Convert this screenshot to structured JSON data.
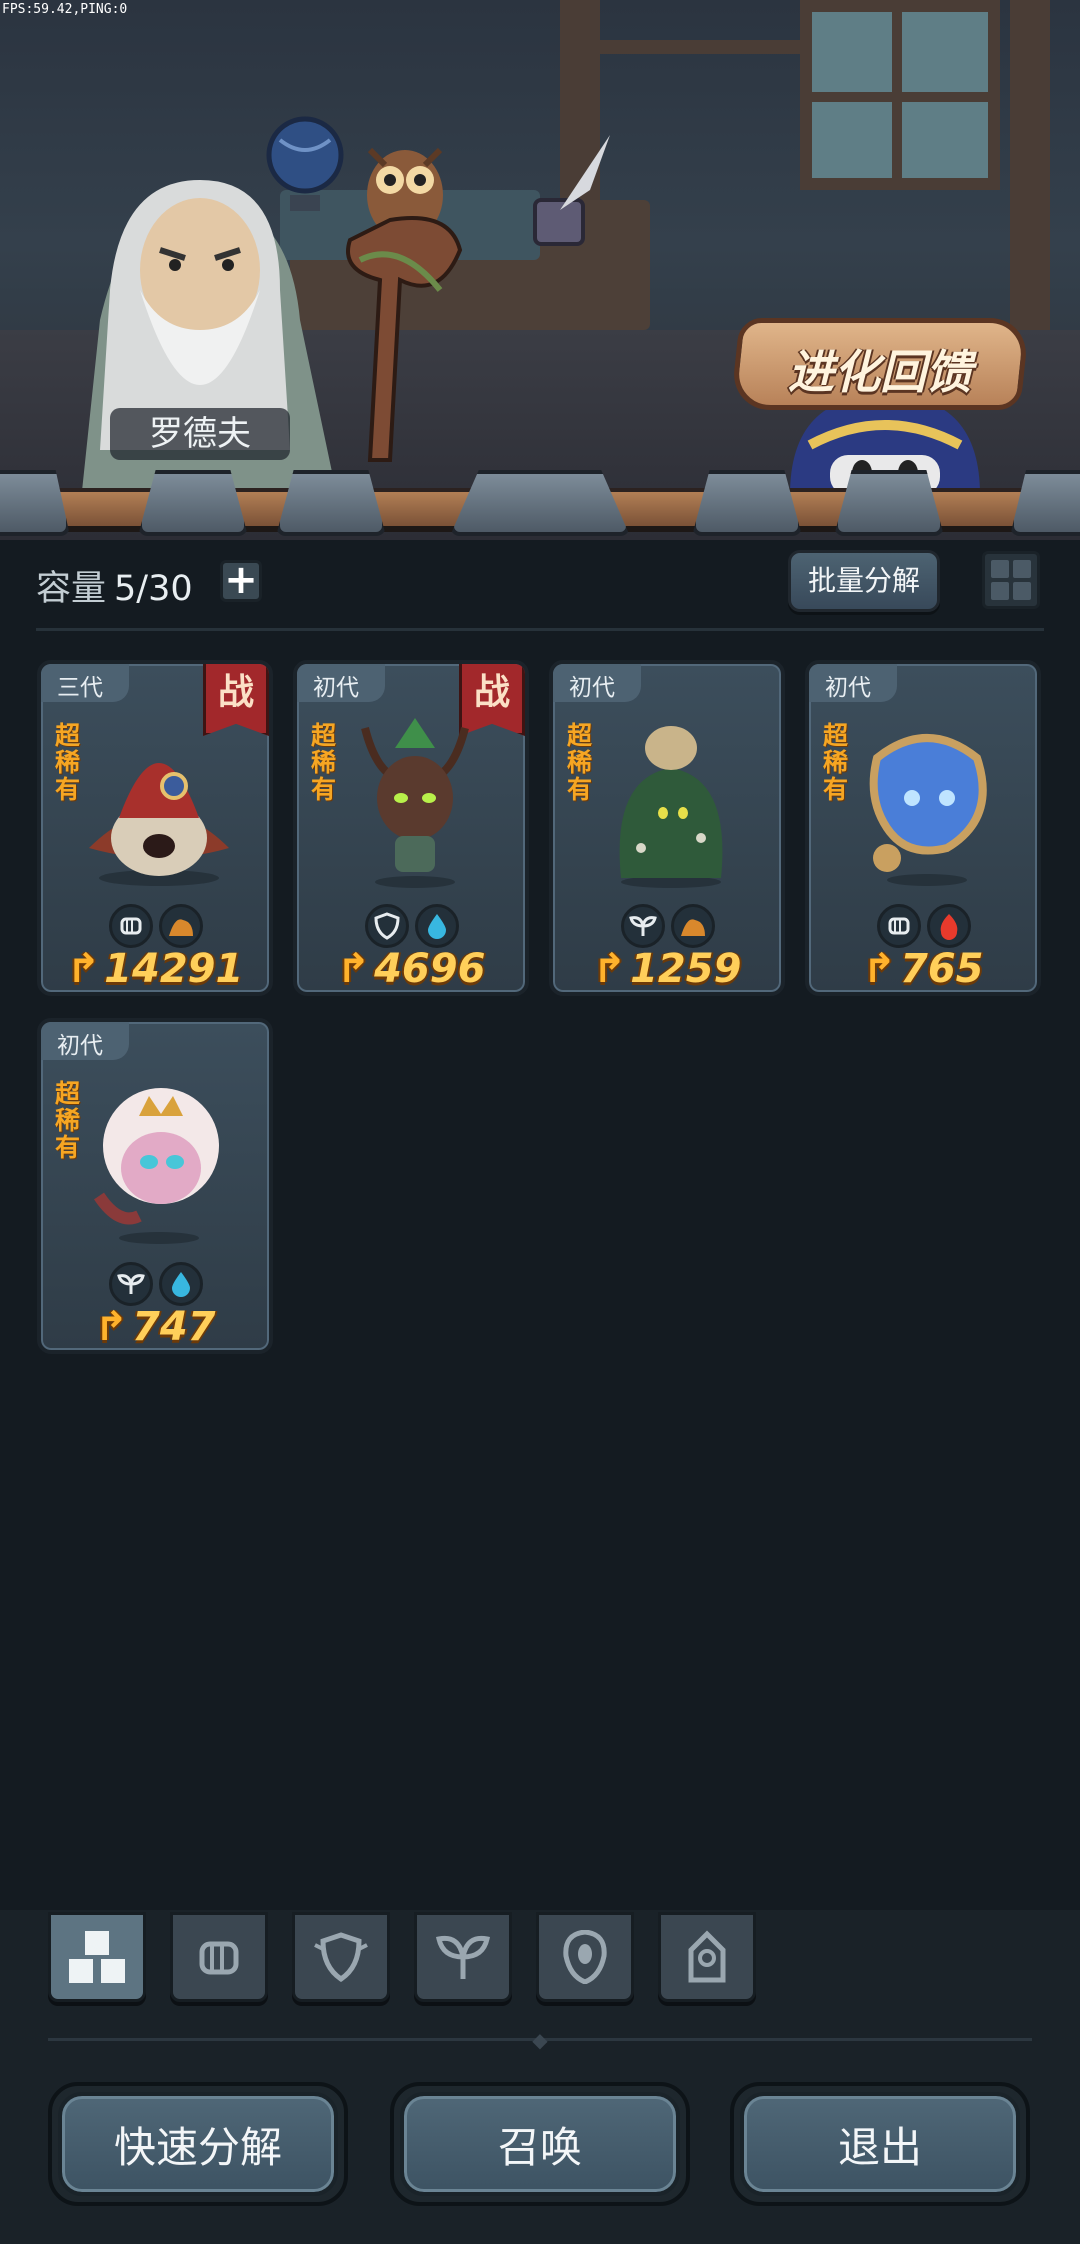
{
  "hud": {
    "fps": "FPS:59.42,PING:0"
  },
  "npc": {
    "name": "罗德夫"
  },
  "banner": {
    "label": "进化回馈"
  },
  "capacity": {
    "label": "容量",
    "value": "5/30"
  },
  "toolbar": {
    "batch_label": "批量分解"
  },
  "cards": [
    {
      "generation": "三代",
      "rarity": "超稀有",
      "battle": "战",
      "power": "14291",
      "elements": [
        "fist-icon",
        "earth-icon"
      ],
      "colors": {
        "body": "#c7b7a3",
        "hat": "#a8302c"
      }
    },
    {
      "generation": "初代",
      "rarity": "超稀有",
      "battle": "战",
      "power": "4696",
      "elements": [
        "shield-icon",
        "water-icon"
      ],
      "colors": {
        "body": "#5a3a2e",
        "hat": "#3f8f4a"
      }
    },
    {
      "generation": "初代",
      "rarity": "超稀有",
      "power": "1259",
      "elements": [
        "leaf-icon",
        "earth-icon"
      ],
      "colors": {
        "body": "#2f5a3a",
        "hat": "#c9b48a"
      }
    },
    {
      "generation": "初代",
      "rarity": "超稀有",
      "power": "765",
      "elements": [
        "fist-icon",
        "fire-icon"
      ],
      "colors": {
        "body": "#4a7ed8",
        "hat": "#c9a060"
      }
    },
    {
      "generation": "初代",
      "rarity": "超稀有",
      "power": "747",
      "elements": [
        "leaf-icon",
        "water-icon"
      ],
      "colors": {
        "body": "#e2aac6",
        "hat": "#f3e8e8"
      }
    }
  ],
  "filter_tabs": [
    "all-icon",
    "fist-icon",
    "shield-icon",
    "leaf-icon",
    "alien-icon",
    "tower-icon"
  ],
  "actions": {
    "quick_decompose": "快速分解",
    "summon": "召唤",
    "exit": "退出"
  }
}
